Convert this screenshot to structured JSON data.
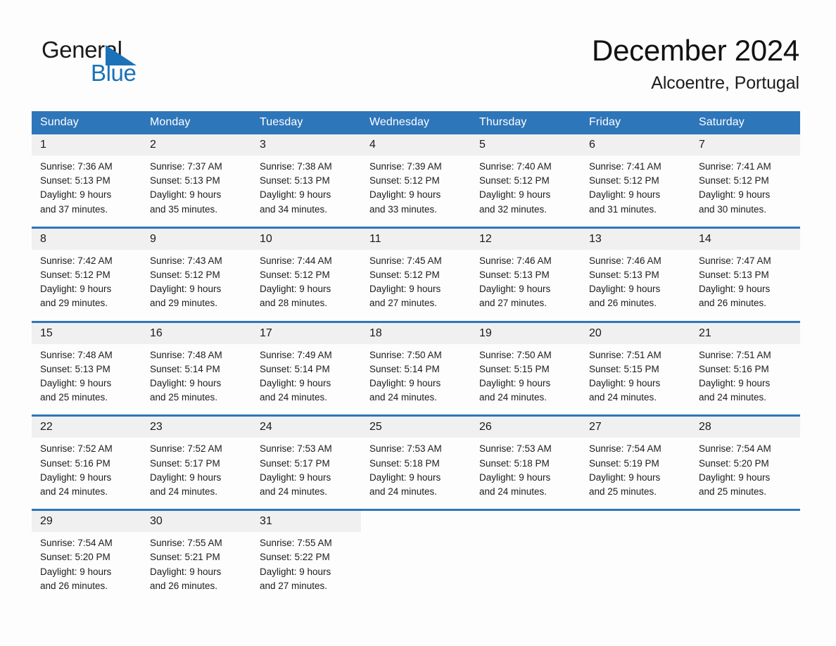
{
  "brand": {
    "name_part1": "General",
    "name_part2": "Blue",
    "triangle_color": "#1b72b8"
  },
  "header": {
    "month_title": "December 2024",
    "location": "Alcoentre, Portugal"
  },
  "theme": {
    "header_blue": "#2e76ba",
    "daynum_background": "#f0f0f0",
    "page_background": "#fdfdfd",
    "text_color": "#1c1c1c"
  },
  "weekdays": [
    "Sunday",
    "Monday",
    "Tuesday",
    "Wednesday",
    "Thursday",
    "Friday",
    "Saturday"
  ],
  "weeks": [
    {
      "days": [
        {
          "num": "1",
          "sunrise": "Sunrise: 7:36 AM",
          "sunset": "Sunset: 5:13 PM",
          "daylight1": "Daylight: 9 hours",
          "daylight2": "and 37 minutes."
        },
        {
          "num": "2",
          "sunrise": "Sunrise: 7:37 AM",
          "sunset": "Sunset: 5:13 PM",
          "daylight1": "Daylight: 9 hours",
          "daylight2": "and 35 minutes."
        },
        {
          "num": "3",
          "sunrise": "Sunrise: 7:38 AM",
          "sunset": "Sunset: 5:13 PM",
          "daylight1": "Daylight: 9 hours",
          "daylight2": "and 34 minutes."
        },
        {
          "num": "4",
          "sunrise": "Sunrise: 7:39 AM",
          "sunset": "Sunset: 5:12 PM",
          "daylight1": "Daylight: 9 hours",
          "daylight2": "and 33 minutes."
        },
        {
          "num": "5",
          "sunrise": "Sunrise: 7:40 AM",
          "sunset": "Sunset: 5:12 PM",
          "daylight1": "Daylight: 9 hours",
          "daylight2": "and 32 minutes."
        },
        {
          "num": "6",
          "sunrise": "Sunrise: 7:41 AM",
          "sunset": "Sunset: 5:12 PM",
          "daylight1": "Daylight: 9 hours",
          "daylight2": "and 31 minutes."
        },
        {
          "num": "7",
          "sunrise": "Sunrise: 7:41 AM",
          "sunset": "Sunset: 5:12 PM",
          "daylight1": "Daylight: 9 hours",
          "daylight2": "and 30 minutes."
        }
      ]
    },
    {
      "days": [
        {
          "num": "8",
          "sunrise": "Sunrise: 7:42 AM",
          "sunset": "Sunset: 5:12 PM",
          "daylight1": "Daylight: 9 hours",
          "daylight2": "and 29 minutes."
        },
        {
          "num": "9",
          "sunrise": "Sunrise: 7:43 AM",
          "sunset": "Sunset: 5:12 PM",
          "daylight1": "Daylight: 9 hours",
          "daylight2": "and 29 minutes."
        },
        {
          "num": "10",
          "sunrise": "Sunrise: 7:44 AM",
          "sunset": "Sunset: 5:12 PM",
          "daylight1": "Daylight: 9 hours",
          "daylight2": "and 28 minutes."
        },
        {
          "num": "11",
          "sunrise": "Sunrise: 7:45 AM",
          "sunset": "Sunset: 5:12 PM",
          "daylight1": "Daylight: 9 hours",
          "daylight2": "and 27 minutes."
        },
        {
          "num": "12",
          "sunrise": "Sunrise: 7:46 AM",
          "sunset": "Sunset: 5:13 PM",
          "daylight1": "Daylight: 9 hours",
          "daylight2": "and 27 minutes."
        },
        {
          "num": "13",
          "sunrise": "Sunrise: 7:46 AM",
          "sunset": "Sunset: 5:13 PM",
          "daylight1": "Daylight: 9 hours",
          "daylight2": "and 26 minutes."
        },
        {
          "num": "14",
          "sunrise": "Sunrise: 7:47 AM",
          "sunset": "Sunset: 5:13 PM",
          "daylight1": "Daylight: 9 hours",
          "daylight2": "and 26 minutes."
        }
      ]
    },
    {
      "days": [
        {
          "num": "15",
          "sunrise": "Sunrise: 7:48 AM",
          "sunset": "Sunset: 5:13 PM",
          "daylight1": "Daylight: 9 hours",
          "daylight2": "and 25 minutes."
        },
        {
          "num": "16",
          "sunrise": "Sunrise: 7:48 AM",
          "sunset": "Sunset: 5:14 PM",
          "daylight1": "Daylight: 9 hours",
          "daylight2": "and 25 minutes."
        },
        {
          "num": "17",
          "sunrise": "Sunrise: 7:49 AM",
          "sunset": "Sunset: 5:14 PM",
          "daylight1": "Daylight: 9 hours",
          "daylight2": "and 24 minutes."
        },
        {
          "num": "18",
          "sunrise": "Sunrise: 7:50 AM",
          "sunset": "Sunset: 5:14 PM",
          "daylight1": "Daylight: 9 hours",
          "daylight2": "and 24 minutes."
        },
        {
          "num": "19",
          "sunrise": "Sunrise: 7:50 AM",
          "sunset": "Sunset: 5:15 PM",
          "daylight1": "Daylight: 9 hours",
          "daylight2": "and 24 minutes."
        },
        {
          "num": "20",
          "sunrise": "Sunrise: 7:51 AM",
          "sunset": "Sunset: 5:15 PM",
          "daylight1": "Daylight: 9 hours",
          "daylight2": "and 24 minutes."
        },
        {
          "num": "21",
          "sunrise": "Sunrise: 7:51 AM",
          "sunset": "Sunset: 5:16 PM",
          "daylight1": "Daylight: 9 hours",
          "daylight2": "and 24 minutes."
        }
      ]
    },
    {
      "days": [
        {
          "num": "22",
          "sunrise": "Sunrise: 7:52 AM",
          "sunset": "Sunset: 5:16 PM",
          "daylight1": "Daylight: 9 hours",
          "daylight2": "and 24 minutes."
        },
        {
          "num": "23",
          "sunrise": "Sunrise: 7:52 AM",
          "sunset": "Sunset: 5:17 PM",
          "daylight1": "Daylight: 9 hours",
          "daylight2": "and 24 minutes."
        },
        {
          "num": "24",
          "sunrise": "Sunrise: 7:53 AM",
          "sunset": "Sunset: 5:17 PM",
          "daylight1": "Daylight: 9 hours",
          "daylight2": "and 24 minutes."
        },
        {
          "num": "25",
          "sunrise": "Sunrise: 7:53 AM",
          "sunset": "Sunset: 5:18 PM",
          "daylight1": "Daylight: 9 hours",
          "daylight2": "and 24 minutes."
        },
        {
          "num": "26",
          "sunrise": "Sunrise: 7:53 AM",
          "sunset": "Sunset: 5:18 PM",
          "daylight1": "Daylight: 9 hours",
          "daylight2": "and 24 minutes."
        },
        {
          "num": "27",
          "sunrise": "Sunrise: 7:54 AM",
          "sunset": "Sunset: 5:19 PM",
          "daylight1": "Daylight: 9 hours",
          "daylight2": "and 25 minutes."
        },
        {
          "num": "28",
          "sunrise": "Sunrise: 7:54 AM",
          "sunset": "Sunset: 5:20 PM",
          "daylight1": "Daylight: 9 hours",
          "daylight2": "and 25 minutes."
        }
      ]
    },
    {
      "days": [
        {
          "num": "29",
          "sunrise": "Sunrise: 7:54 AM",
          "sunset": "Sunset: 5:20 PM",
          "daylight1": "Daylight: 9 hours",
          "daylight2": "and 26 minutes."
        },
        {
          "num": "30",
          "sunrise": "Sunrise: 7:55 AM",
          "sunset": "Sunset: 5:21 PM",
          "daylight1": "Daylight: 9 hours",
          "daylight2": "and 26 minutes."
        },
        {
          "num": "31",
          "sunrise": "Sunrise: 7:55 AM",
          "sunset": "Sunset: 5:22 PM",
          "daylight1": "Daylight: 9 hours",
          "daylight2": "and 27 minutes."
        },
        {
          "num": "",
          "sunrise": "",
          "sunset": "",
          "daylight1": "",
          "daylight2": ""
        },
        {
          "num": "",
          "sunrise": "",
          "sunset": "",
          "daylight1": "",
          "daylight2": ""
        },
        {
          "num": "",
          "sunrise": "",
          "sunset": "",
          "daylight1": "",
          "daylight2": ""
        },
        {
          "num": "",
          "sunrise": "",
          "sunset": "",
          "daylight1": "",
          "daylight2": ""
        }
      ]
    }
  ]
}
